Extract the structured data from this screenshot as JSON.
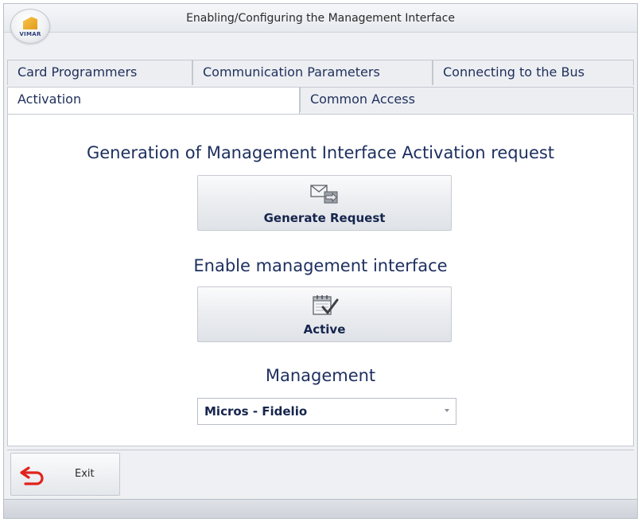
{
  "window": {
    "title": "Enabling/Configuring the Management Interface",
    "logo_text": "VIMAR"
  },
  "tabs": {
    "row1": [
      {
        "label": "Card Programmers"
      },
      {
        "label": "Communication Parameters"
      },
      {
        "label": "Connecting to the Bus"
      }
    ],
    "row2": [
      {
        "label": "Activation",
        "active": true
      },
      {
        "label": "Common Access"
      }
    ]
  },
  "main": {
    "generation_heading": "Generation of Management Interface Activation request",
    "generate_button_label": "Generate Request",
    "generate_icon": "envelope-forward-icon",
    "enable_heading": "Enable management interface",
    "active_button_label": "Active",
    "active_icon": "calendar-check-icon",
    "management_heading": "Management",
    "management_select_value": "Micros - Fidelio"
  },
  "footer": {
    "exit_label": "Exit",
    "exit_icon": "undo-arrow-icon",
    "exit_icon_color": "#e0231c"
  }
}
